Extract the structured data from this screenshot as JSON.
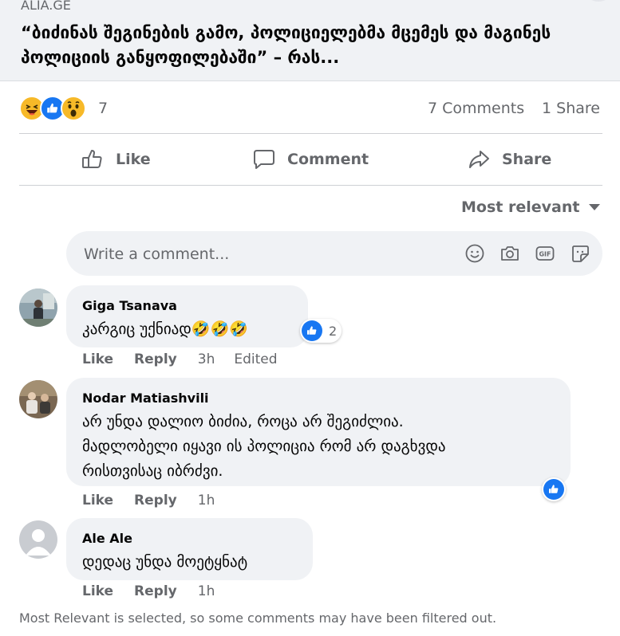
{
  "link_preview": {
    "domain": "ALIA.GE",
    "title": "“ბიძინას შეგინების გამო, პოლიციელებმა მცემეს და მაგინეს პოლიციის განყოფილებაში” – რას..."
  },
  "reactions": {
    "icons": [
      "haha-icon",
      "like-icon",
      "wow-icon"
    ],
    "count": "7",
    "comments": "7 Comments",
    "shares": "1 Share"
  },
  "actions": {
    "like": "Like",
    "comment": "Comment",
    "share": "Share"
  },
  "sort": {
    "label": "Most relevant"
  },
  "composer": {
    "placeholder": "Write a comment...",
    "icons": [
      "emoji-icon",
      "camera-icon",
      "gif-icon",
      "sticker-icon"
    ]
  },
  "comments": [
    {
      "author": "Giga Tsanava",
      "lines": [
        "კარგიც უქნიად🤣🤣🤣"
      ],
      "reaction_count": "2",
      "like": "Like",
      "reply": "Reply",
      "time": "3h",
      "edited": "Edited"
    },
    {
      "author": "Nodar Matiashvili",
      "lines": [
        "არ უნდა დალიო ბიძია, როცა არ შეგიძლია.",
        "მადლობელი იყავი ის პოლიცია რომ არ დაგხვდა",
        "რისთვისაც იბრძვი."
      ],
      "like": "Like",
      "reply": "Reply",
      "time": "1h"
    },
    {
      "author": "Ale Ale",
      "lines": [
        "დედაც უნდა მოეტყნატ"
      ],
      "like": "Like",
      "reply": "Reply",
      "time": "1h"
    }
  ],
  "footnote": "Most Relevant is selected, so some comments may have been filtered out.",
  "colors": {
    "accent": "#1877f2",
    "secondary_text": "#65676b",
    "bubble": "#f0f2f5"
  }
}
